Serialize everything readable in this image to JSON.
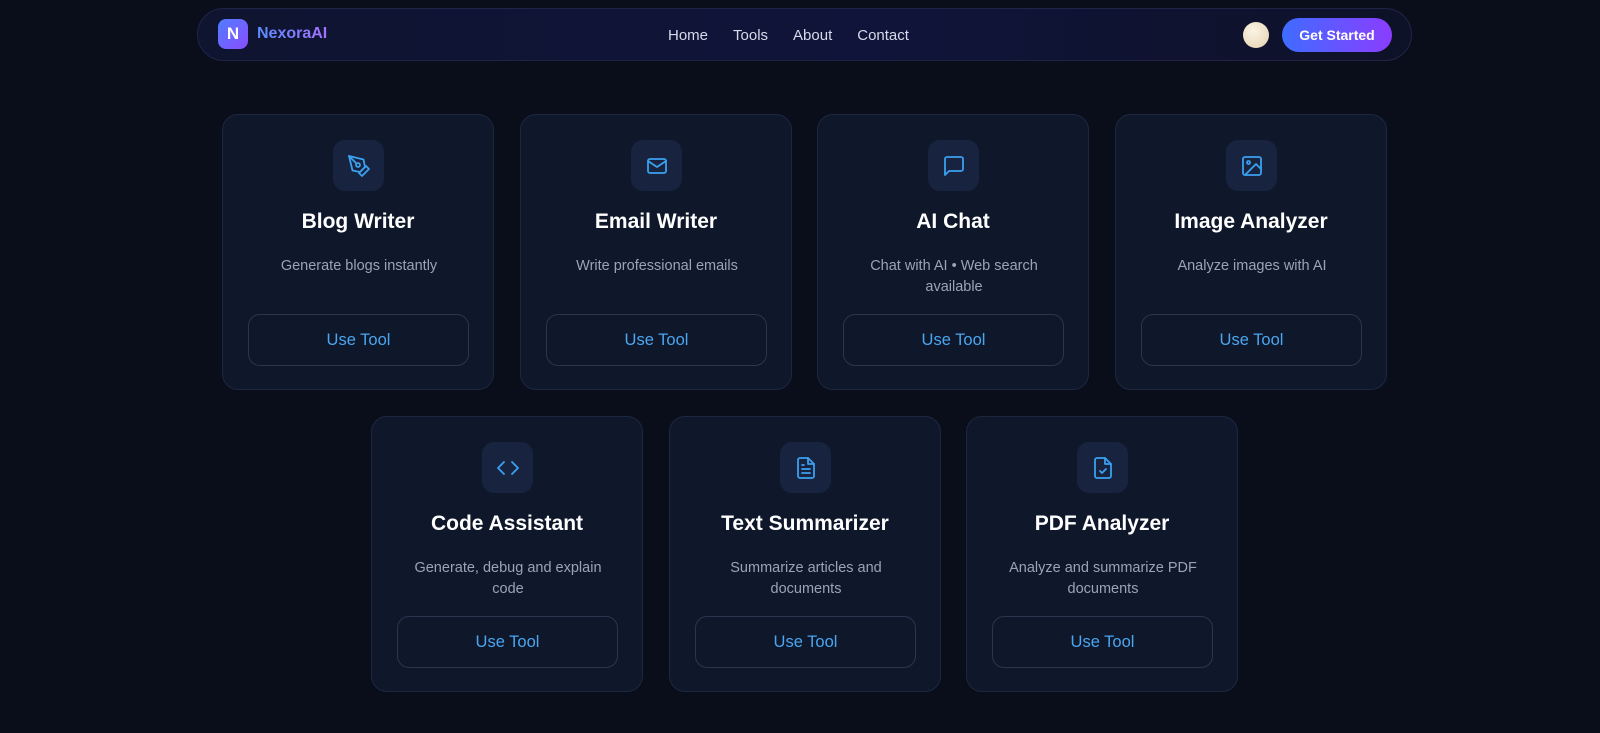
{
  "brand": {
    "logo_letter": "N",
    "name": "NexoraAI"
  },
  "nav": {
    "links": [
      "Home",
      "Tools",
      "About",
      "Contact"
    ]
  },
  "header": {
    "cta_label": "Get Started"
  },
  "tools": [
    {
      "title": "Blog Writer",
      "description": "Generate blogs instantly",
      "button_label": "Use Tool",
      "icon": "pen-tool-icon"
    },
    {
      "title": "Email Writer",
      "description": "Write professional emails",
      "button_label": "Use Tool",
      "icon": "mail-icon"
    },
    {
      "title": "AI Chat",
      "description": "Chat with AI • Web search available",
      "button_label": "Use Tool",
      "icon": "chat-bubble-icon"
    },
    {
      "title": "Image Analyzer",
      "description": "Analyze images with AI",
      "button_label": "Use Tool",
      "icon": "image-icon"
    },
    {
      "title": "Code Assistant",
      "description": "Generate, debug and explain code",
      "button_label": "Use Tool",
      "icon": "code-icon"
    },
    {
      "title": "Text Summarizer",
      "description": "Summarize articles and documents",
      "button_label": "Use Tool",
      "icon": "document-text-icon"
    },
    {
      "title": "PDF Analyzer",
      "description": "Analyze and summarize PDF documents",
      "button_label": "Use Tool",
      "icon": "document-check-icon"
    }
  ],
  "colors": {
    "accent": "#3aa0f0",
    "background": "#0a0e1a",
    "card": "#0f172a",
    "cta_start": "#3f6cff",
    "cta_end": "#8b3dff"
  }
}
